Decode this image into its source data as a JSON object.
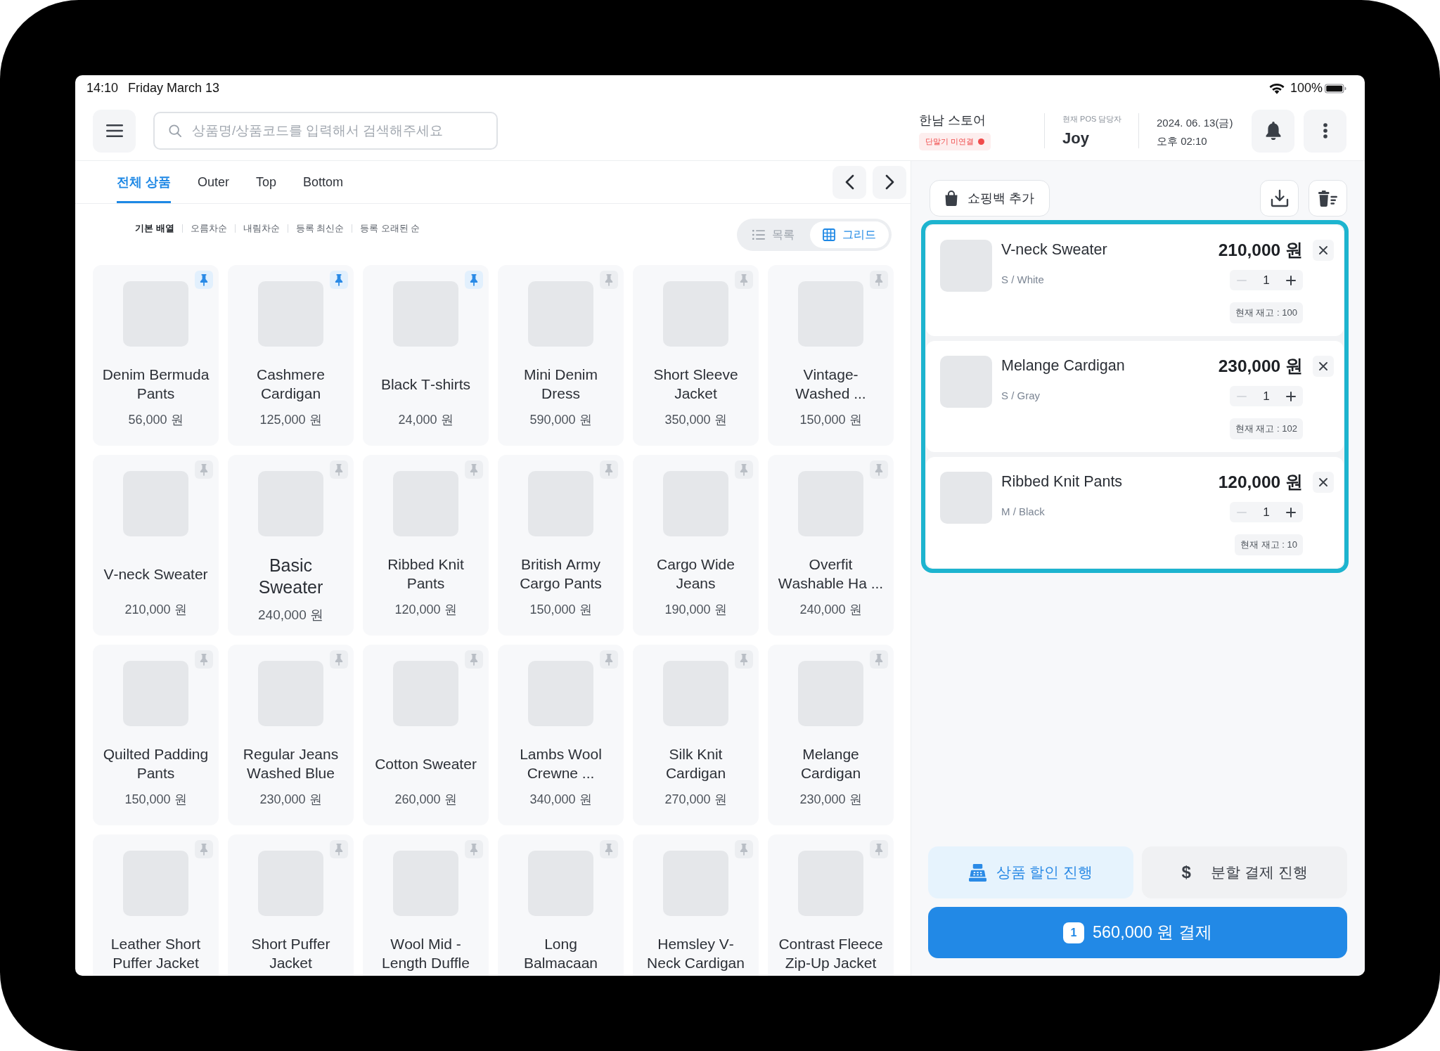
{
  "status_bar": {
    "time": "14:10",
    "date": "Friday March 13",
    "battery": "100%"
  },
  "header": {
    "search": {
      "placeholder": "상품명/상품코드를 입력해서 검색해주세요"
    },
    "store": {
      "name": "한남 스토어",
      "terminal": {
        "label": "단말기 미연결",
        "connected": false
      }
    },
    "staff": {
      "label": "현재 POS 담당자",
      "name": "Joy"
    },
    "datetime": {
      "date": "2024. 06. 13(금)",
      "time": "오후 02:10"
    }
  },
  "tabs": [
    {
      "label": "전체 상품",
      "selected": true
    },
    {
      "label": "Outer",
      "selected": false
    },
    {
      "label": "Top",
      "selected": false
    },
    {
      "label": "Bottom",
      "selected": false
    }
  ],
  "sort_options": [
    {
      "label": "기본 배열",
      "selected": true
    },
    {
      "label": "오름차순",
      "selected": false
    },
    {
      "label": "내림차순",
      "selected": false
    },
    {
      "label": "등록 최신순",
      "selected": false
    },
    {
      "label": "등록 오래된 순",
      "selected": false
    }
  ],
  "view_modes": [
    {
      "kind": "list",
      "label": "목록",
      "selected": false
    },
    {
      "kind": "grid",
      "label": "그리드",
      "selected": true
    }
  ],
  "products": [
    {
      "name": "Denim Bermuda Pants",
      "price": "56,000 원",
      "pinned": true,
      "kind": "standard"
    },
    {
      "name": "Cashmere Cardigan",
      "price": "125,000 원",
      "pinned": true,
      "kind": "standard"
    },
    {
      "name": "Black T-shirts",
      "price": "24,000 원",
      "pinned": true,
      "kind": "standard"
    },
    {
      "name": "Mini Denim Dress",
      "price": "590,000 원",
      "pinned": false,
      "kind": "standard"
    },
    {
      "name": "Short Sleeve Jacket",
      "price": "350,000 원",
      "pinned": false,
      "kind": "standard"
    },
    {
      "name": "Vintage-Washed ...",
      "price": "150,000 원",
      "pinned": false,
      "kind": "standard"
    },
    {
      "name": "V-neck Sweater",
      "price": "210,000 원",
      "pinned": false,
      "kind": "standard"
    },
    {
      "name": "Basic Sweater",
      "price": "240,000 원",
      "pinned": false,
      "kind": "large"
    },
    {
      "name": "Ribbed Knit Pants",
      "price": "120,000 원",
      "pinned": false,
      "kind": "standard"
    },
    {
      "name": "British Army Cargo Pants",
      "price": "150,000 원",
      "pinned": false,
      "kind": "standard"
    },
    {
      "name": "Cargo Wide Jeans",
      "price": "190,000 원",
      "pinned": false,
      "kind": "standard"
    },
    {
      "name": "Overfit Washable Ha ...",
      "price": "240,000 원",
      "pinned": false,
      "kind": "standard"
    },
    {
      "name": "Quilted Padding Pants",
      "price": "150,000 원",
      "pinned": false,
      "kind": "standard"
    },
    {
      "name": "Regular Jeans Washed Blue",
      "price": "230,000 원",
      "pinned": false,
      "kind": "standard"
    },
    {
      "name": "Cotton Sweater",
      "price": "260,000 원",
      "pinned": false,
      "kind": "standard"
    },
    {
      "name": "Lambs Wool Crewne ...",
      "price": "340,000 원",
      "pinned": false,
      "kind": "standard"
    },
    {
      "name": "Silk Knit Cardigan",
      "price": "270,000 원",
      "pinned": false,
      "kind": "standard"
    },
    {
      "name": "Melange Cardigan",
      "price": "230,000 원",
      "pinned": false,
      "kind": "standard"
    },
    {
      "name": "Leather Short Puffer Jacket",
      "pinned": false,
      "kind": "standard"
    },
    {
      "name": "Short Puffer Jacket",
      "pinned": false,
      "kind": "standard"
    },
    {
      "name": "Wool Mid - Length Duffle",
      "pinned": false,
      "kind": "standard"
    },
    {
      "name": "Long Balmacaan",
      "pinned": false,
      "kind": "standard"
    },
    {
      "name": "Hemsley V-Neck Cardigan",
      "pinned": false,
      "kind": "standard"
    },
    {
      "name": "Contrast Fleece Zip-Up Jacket",
      "pinned": false,
      "kind": "standard"
    }
  ],
  "cart": {
    "add_bag": "쇼핑백 추가",
    "highlighted": true,
    "items": [
      {
        "name": "V-neck Sweater",
        "option": "S / White",
        "price": "210,000 원",
        "quantity": "1",
        "decrease_disabled": true,
        "stock": "현재 재고 : 100"
      },
      {
        "name": "Melange Cardigan",
        "option": "S / Gray",
        "price": "230,000 원",
        "quantity": "1",
        "decrease_disabled": true,
        "stock": "현재 재고 : 102"
      },
      {
        "name": "Ribbed Knit Pants",
        "option": "M / Black",
        "price": "120,000 원",
        "quantity": "1",
        "decrease_disabled": true,
        "stock": "현재 재고 : 10"
      }
    ]
  },
  "actions": {
    "discount": "상품 할인 진행",
    "split_payment": {
      "icon": "$",
      "label": "분할 결제 진행"
    },
    "pay": {
      "count": "1",
      "label": "560,000 원 결제"
    }
  }
}
